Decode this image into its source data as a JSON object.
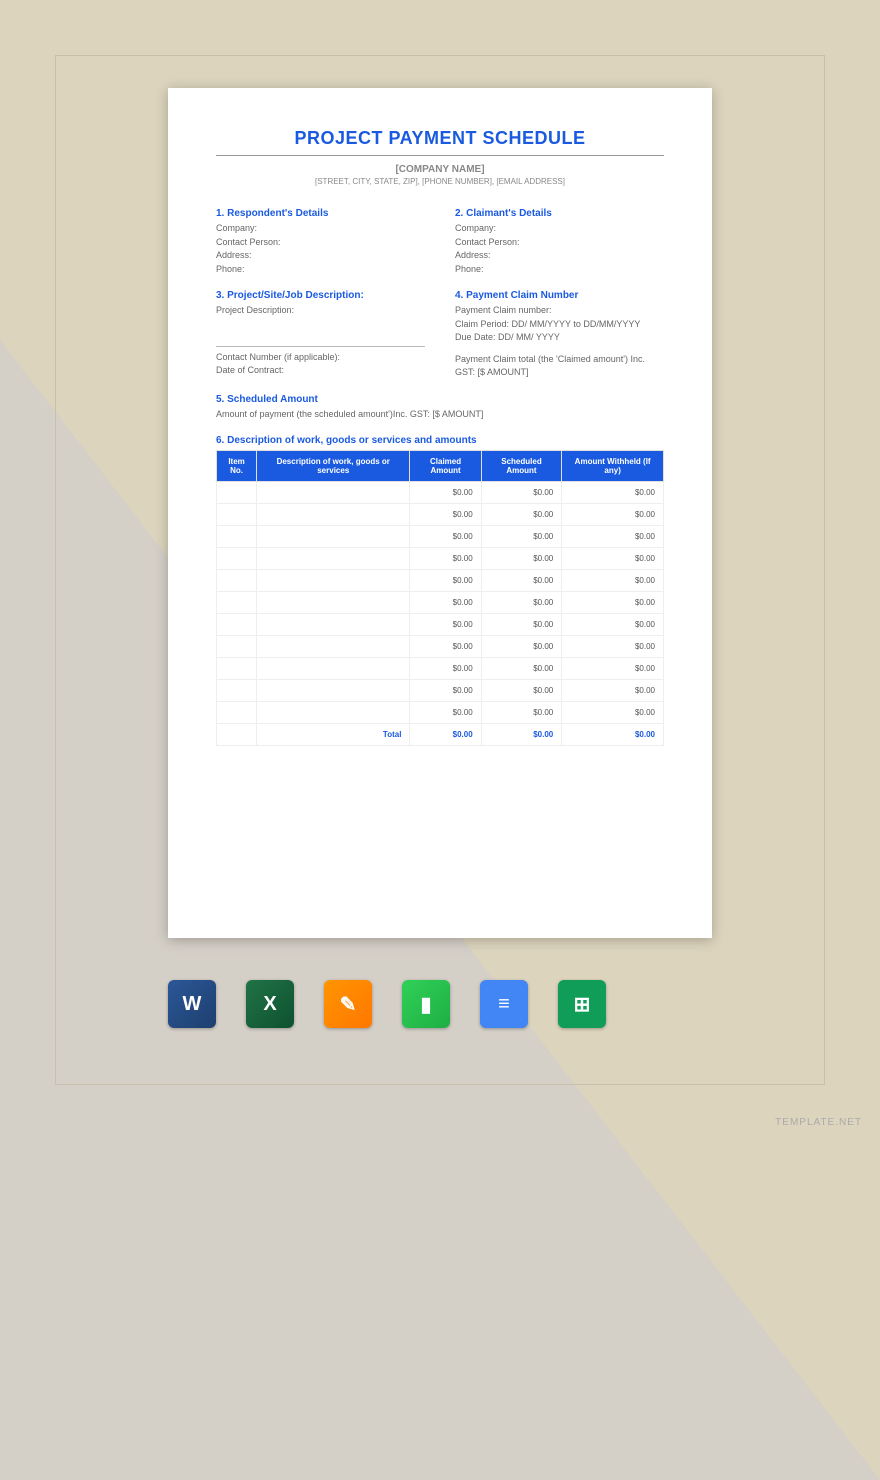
{
  "title": "PROJECT PAYMENT SCHEDULE",
  "header": {
    "company_name": "[COMPANY NAME]",
    "contact_line": "[STREET, CITY, STATE, ZIP], [PHONE NUMBER], [EMAIL ADDRESS]"
  },
  "sections": {
    "respondent": {
      "heading": "1. Respondent's Details",
      "company": "Company:",
      "contact_person": "Contact Person:",
      "address": "Address:",
      "phone": "Phone:"
    },
    "claimant": {
      "heading": "2. Claimant's Details",
      "company": "Company:",
      "contact_person": "Contact Person:",
      "address": "Address:",
      "phone": "Phone:"
    },
    "project": {
      "heading": "3. Project/Site/Job Description:",
      "description": "Project Description:",
      "contact_number": "Contact Number (if applicable):",
      "date_of_contract": "Date of Contract:"
    },
    "payment_claim": {
      "heading": "4. Payment Claim Number",
      "number": "Payment Claim number:",
      "period": "Claim Period: DD/ MM/YYYY to DD/MM/YYYY",
      "due_date": "Due Date: DD/ MM/ YYYY",
      "total": "Payment Claim total (the 'Claimed amount') Inc. GST: [$ AMOUNT]"
    },
    "scheduled": {
      "heading": "5. Scheduled Amount",
      "text": "Amount of payment (the scheduled amount')Inc. GST: [$ AMOUNT]"
    },
    "work_desc": {
      "heading": "6. Description of work, goods or services and amounts"
    }
  },
  "table": {
    "headers": {
      "item_no": "Item No.",
      "description": "Description of work, goods or services",
      "claimed": "Claimed Amount",
      "scheduled": "Scheduled Amount",
      "withheld": "Amount Withheld (If any)"
    },
    "rows": [
      {
        "item": "",
        "desc": "",
        "claimed": "$0.00",
        "scheduled": "$0.00",
        "withheld": "$0.00"
      },
      {
        "item": "",
        "desc": "",
        "claimed": "$0.00",
        "scheduled": "$0.00",
        "withheld": "$0.00"
      },
      {
        "item": "",
        "desc": "",
        "claimed": "$0.00",
        "scheduled": "$0.00",
        "withheld": "$0.00"
      },
      {
        "item": "",
        "desc": "",
        "claimed": "$0.00",
        "scheduled": "$0.00",
        "withheld": "$0.00"
      },
      {
        "item": "",
        "desc": "",
        "claimed": "$0.00",
        "scheduled": "$0.00",
        "withheld": "$0.00"
      },
      {
        "item": "",
        "desc": "",
        "claimed": "$0.00",
        "scheduled": "$0.00",
        "withheld": "$0.00"
      },
      {
        "item": "",
        "desc": "",
        "claimed": "$0.00",
        "scheduled": "$0.00",
        "withheld": "$0.00"
      },
      {
        "item": "",
        "desc": "",
        "claimed": "$0.00",
        "scheduled": "$0.00",
        "withheld": "$0.00"
      },
      {
        "item": "",
        "desc": "",
        "claimed": "$0.00",
        "scheduled": "$0.00",
        "withheld": "$0.00"
      },
      {
        "item": "",
        "desc": "",
        "claimed": "$0.00",
        "scheduled": "$0.00",
        "withheld": "$0.00"
      },
      {
        "item": "",
        "desc": "",
        "claimed": "$0.00",
        "scheduled": "$0.00",
        "withheld": "$0.00"
      }
    ],
    "total": {
      "label": "Total",
      "claimed": "$0.00",
      "scheduled": "$0.00",
      "withheld": "$0.00"
    }
  },
  "icons": {
    "word": "W",
    "excel": "X",
    "pages": "✎",
    "numbers": "▮",
    "gdocs": "≡",
    "gsheets": "⊞"
  },
  "watermark": "TEMPLATE.NET"
}
